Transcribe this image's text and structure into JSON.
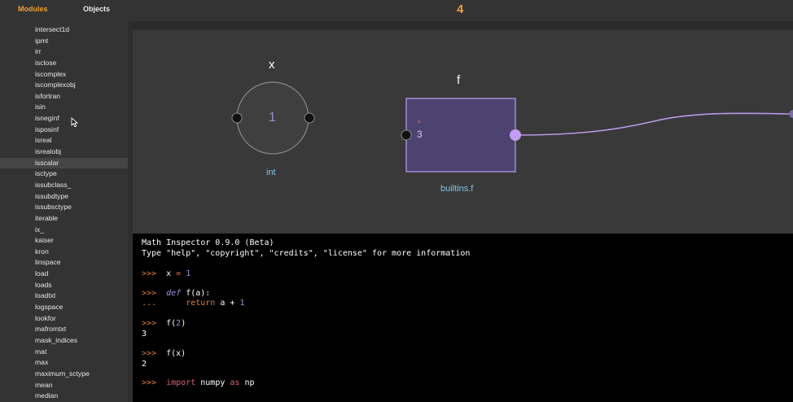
{
  "header": {
    "tabs": [
      {
        "label": "Modules",
        "active": true
      },
      {
        "label": "Objects",
        "active": false
      }
    ],
    "counter": "4"
  },
  "sidebar": {
    "items": [
      "intersect1d",
      "ipmt",
      "irr",
      "isclose",
      "iscomplex",
      "iscomplexobj",
      "isfortran",
      "isin",
      "isneginf",
      "isposinf",
      "isreal",
      "isrealobj",
      "isscalar",
      "isctype",
      "issubclass_",
      "issubdtype",
      "issubsctype",
      "iterable",
      "ix_",
      "kaiser",
      "kron",
      "linspace",
      "load",
      "loads",
      "loadtxt",
      "logspace",
      "lookfor",
      "mafromtxt",
      "mask_indices",
      "mat",
      "max",
      "maximum_sctype",
      "mean",
      "median"
    ],
    "selected_item": "isscalar"
  },
  "canvas": {
    "node_x": {
      "title": "x",
      "value": "1",
      "type": "int"
    },
    "node_f": {
      "title": "f",
      "arg_label": "a",
      "arg_value": "3",
      "type": "builtins.f"
    },
    "colors": {
      "accent": "#f0a030",
      "node_fill": "#4d4370",
      "node_stroke": "#a18bd8",
      "port": "#c49cf5",
      "type_text": "#7fc6e8"
    }
  },
  "console": {
    "banner1": "Math Inspector 0.9.0 (Beta)",
    "banner2": "Type \"help\", \"copyright\", \"credits\", \"license\" for more information",
    "prompt": ">>>",
    "continuation": "...",
    "l1_var": "x",
    "l1_op": "=",
    "l1_val": "1",
    "l2_kw": "def",
    "l2_rest": "f(a):",
    "l3_kw": "return",
    "l3_rest": "a +",
    "l3_val": "1",
    "l4_fn": "f(",
    "l4_arg": "2",
    "l4_close": ")",
    "l4_out": "3",
    "l5_code": "f(x)",
    "l5_out": "2",
    "l6_kw1": "import",
    "l6_mod": "numpy",
    "l6_kw2": "as",
    "l6_alias": "np"
  }
}
